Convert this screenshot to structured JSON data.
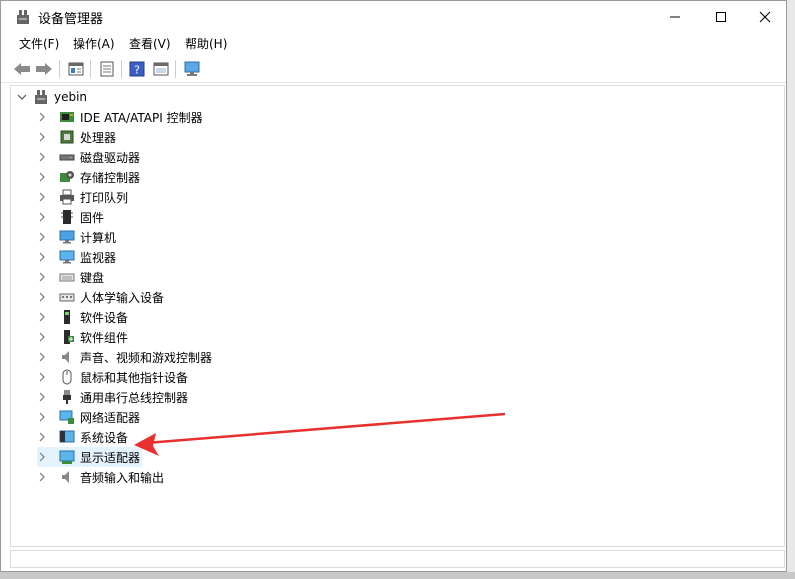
{
  "window": {
    "title": "设备管理器"
  },
  "menu": {
    "file": "文件(F)",
    "action": "操作(A)",
    "view": "查看(V)",
    "help": "帮助(H)"
  },
  "toolbar": {
    "buttons": [
      "back-arrow-icon",
      "forward-arrow-icon",
      "properties-icon",
      "update-icon",
      "help-icon",
      "show-hidden-icon",
      "monitor-icon"
    ]
  },
  "tree": {
    "root": "yebin",
    "items": [
      {
        "label": "IDE ATA/ATAPI 控制器",
        "icon": "ide-controller-icon"
      },
      {
        "label": "处理器",
        "icon": "processor-icon"
      },
      {
        "label": "磁盘驱动器",
        "icon": "disk-drive-icon"
      },
      {
        "label": "存储控制器",
        "icon": "storage-controller-icon"
      },
      {
        "label": "打印队列",
        "icon": "printer-icon"
      },
      {
        "label": "固件",
        "icon": "firmware-icon"
      },
      {
        "label": "计算机",
        "icon": "computer-icon"
      },
      {
        "label": "监视器",
        "icon": "monitor-icon"
      },
      {
        "label": "键盘",
        "icon": "keyboard-icon"
      },
      {
        "label": "人体学输入设备",
        "icon": "hid-icon"
      },
      {
        "label": "软件设备",
        "icon": "software-device-icon"
      },
      {
        "label": "软件组件",
        "icon": "software-component-icon"
      },
      {
        "label": "声音、视频和游戏控制器",
        "icon": "speaker-icon"
      },
      {
        "label": "鼠标和其他指针设备",
        "icon": "mouse-icon"
      },
      {
        "label": "通用串行总线控制器",
        "icon": "usb-icon"
      },
      {
        "label": "网络适配器",
        "icon": "network-adapter-icon"
      },
      {
        "label": "系统设备",
        "icon": "system-device-icon"
      },
      {
        "label": "显示适配器",
        "icon": "display-adapter-icon",
        "selected": true
      },
      {
        "label": "音频输入和输出",
        "icon": "audio-io-icon"
      }
    ]
  },
  "annotation": {
    "color": "#e8312f",
    "points_to": "显示适配器"
  },
  "colors": {
    "selection": "#e5f3ff",
    "accent": "#0078d7"
  }
}
